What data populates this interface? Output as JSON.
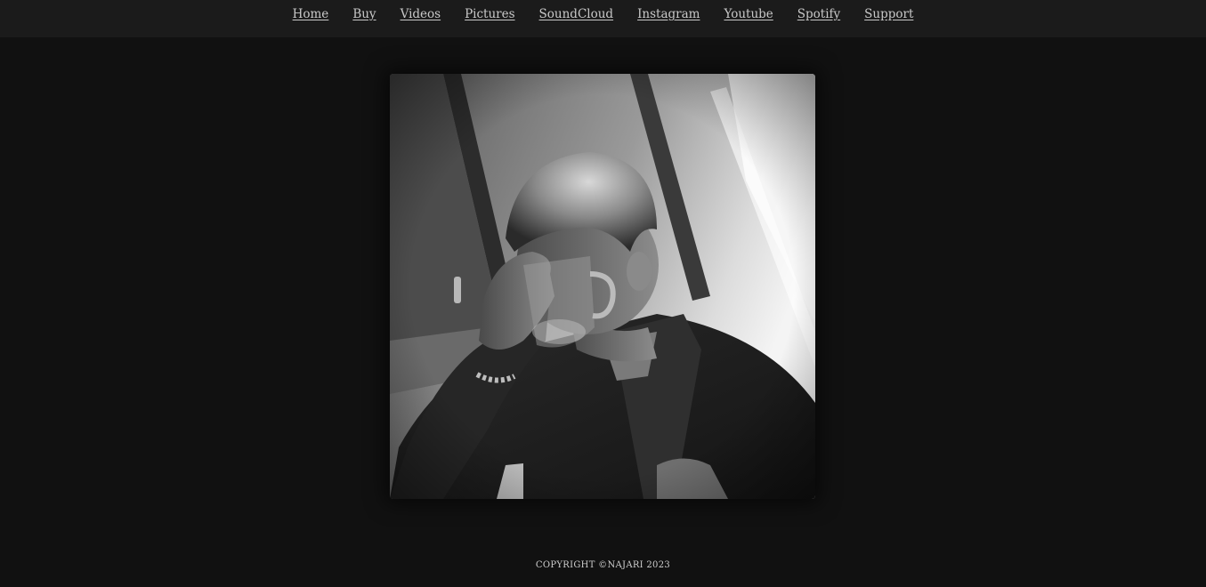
{
  "nav": {
    "items": [
      {
        "label": "Home"
      },
      {
        "label": "Buy"
      },
      {
        "label": "Videos"
      },
      {
        "label": "Pictures"
      },
      {
        "label": "SoundCloud"
      },
      {
        "label": "Instagram"
      },
      {
        "label": "Youtube"
      },
      {
        "label": "Spotify"
      },
      {
        "label": "Support"
      }
    ]
  },
  "photo": {
    "subject": "black-and-white portrait of a man drinking from a glass mug"
  },
  "footer": {
    "copyright": "COPYRIGHT ©NAJARI 2023"
  },
  "colors": {
    "background": "#111111",
    "topbar": "#1b1b1b",
    "link": "#c9c9c9"
  }
}
